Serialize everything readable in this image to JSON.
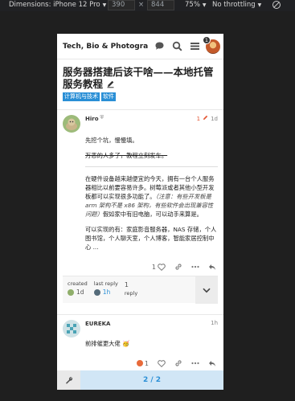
{
  "devtools": {
    "dimensions_label": "Dimensions: iPhone 12 Pro",
    "width": "390",
    "times": "×",
    "height": "844",
    "zoom": "75%",
    "throttle": "No throttling"
  },
  "header": {
    "site_title": "Tech, Bio & Photography",
    "notification_count": "1",
    "icons": [
      "chat-icon",
      "search-icon",
      "menu-icon"
    ]
  },
  "topic": {
    "title": "服务器搭建后该干啥——本地托管服务教程",
    "tags": [
      "计算机与技术",
      "软件"
    ]
  },
  "post1": {
    "username": "Hiro",
    "edit_count": "1",
    "age": "1d",
    "p1": "先挖个坑，慢慢填。",
    "p2_strike": "万恶的人多了，教程立刻发车。",
    "p3_a": "在硬件设备越来越便宜的今天，拥有一台个人服务器相比以前要容易许多。树莓派或者其他小型开发板都可以实现很多功能了。",
    "p3_em": "（注意：有些开发板是 arm 架构不是 x86 架构，有些软件会出现兼容性问题）",
    "p3_b": "假如家中有旧电脑，可以动手来算是。",
    "p4": "可以实现的有：家庭影音服务器，NAS 存储，个人图书馆，个人聊天室，个人博客，智能家居控制中心 ...",
    "likes": "1"
  },
  "summary": {
    "created_label": "created",
    "created_value": "1d",
    "last_reply_label": "last reply",
    "last_reply_value": "1h",
    "reply_count": "1",
    "reply_label": "reply"
  },
  "post2": {
    "username": "EUREKA",
    "age": "1h",
    "text": "前排催更大佬",
    "emoji": "🥳",
    "likes": "1"
  },
  "footer": {
    "progress": "2 / 2",
    "progress_fraction": 1.0
  },
  "colors": {
    "accent": "#2a8fd6",
    "edit": "#e45735"
  }
}
